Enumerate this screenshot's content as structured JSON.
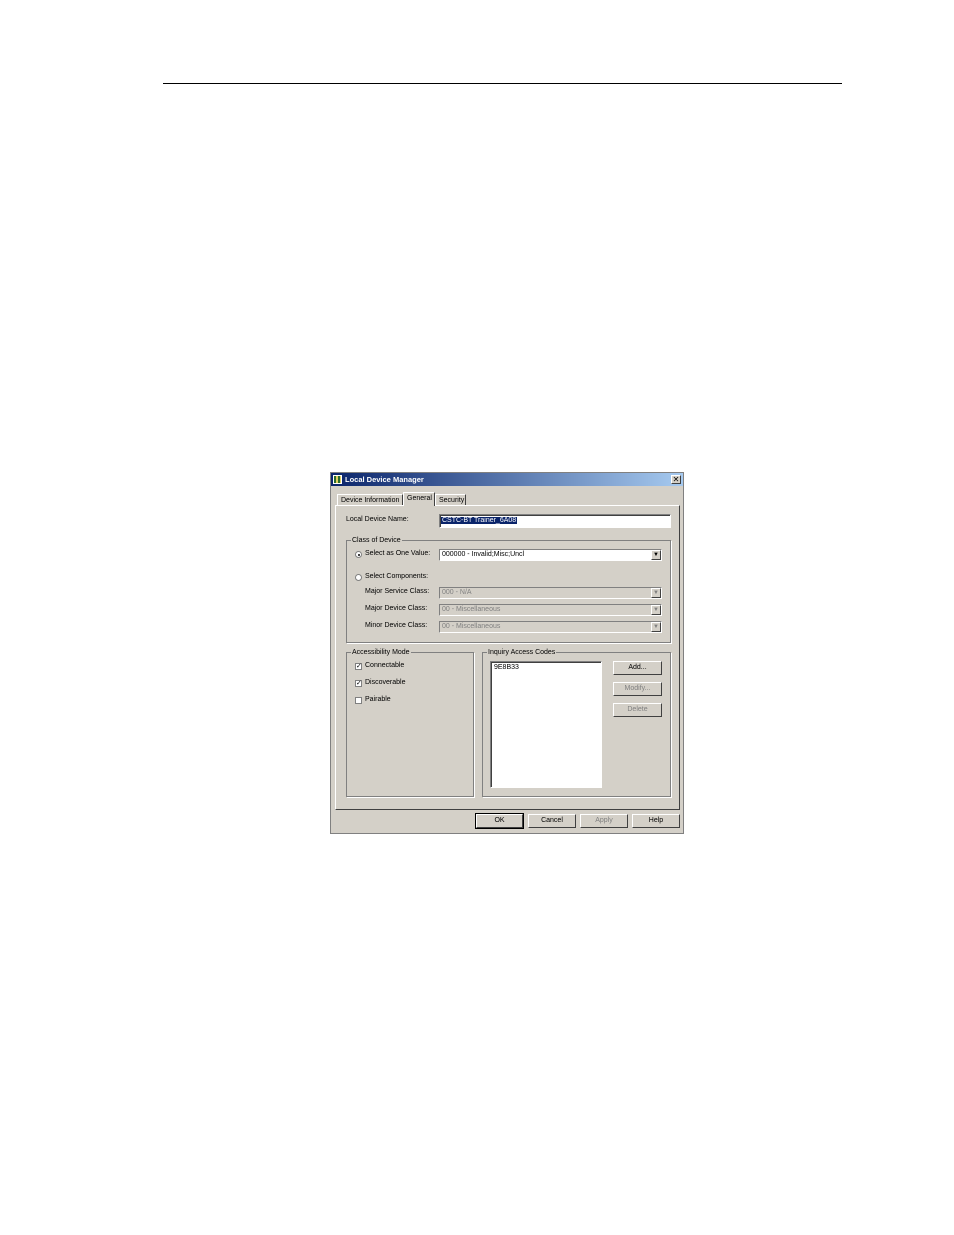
{
  "window": {
    "title": "Local Device Manager",
    "close_glyph": "✕"
  },
  "tabs": [
    {
      "label": "Device Information",
      "active": false
    },
    {
      "label": "General",
      "active": true
    },
    {
      "label": "Security",
      "active": false
    }
  ],
  "general": {
    "device_name_label": "Local Device Name:",
    "device_name_value": "CSTC-BT Trainer_6A08",
    "class_group_label": "Class of Device",
    "select_one_label": "Select as One Value:",
    "select_one_value": "000000 - Invalid;Misc;Uncl",
    "select_components_label": "Select Components:",
    "major_service_label": "Major Service Class:",
    "major_service_value": "000 - N/A",
    "major_device_label": "Major Device Class:",
    "major_device_value": "00 - Miscellaneous",
    "minor_device_label": "Minor Device Class:",
    "minor_device_value": "00 - Miscellaneous",
    "accessibility_label": "Accessibility Mode",
    "connectable_label": "Connectable",
    "connectable_checked": true,
    "discoverable_label": "Discoverable",
    "discoverable_checked": true,
    "pairable_label": "Pairable",
    "pairable_checked": false,
    "inquiry_label": "Inquiry Access Codes",
    "inquiry_codes": [
      "9E8B33"
    ],
    "add_label": "Add...",
    "modify_label": "Modify...",
    "delete_label": "Delete"
  },
  "footer": {
    "ok_label": "OK",
    "cancel_label": "Cancel",
    "apply_label": "Apply",
    "help_label": "Help"
  },
  "icons": {
    "dropdown_arrow": "▼",
    "check": "✓"
  }
}
